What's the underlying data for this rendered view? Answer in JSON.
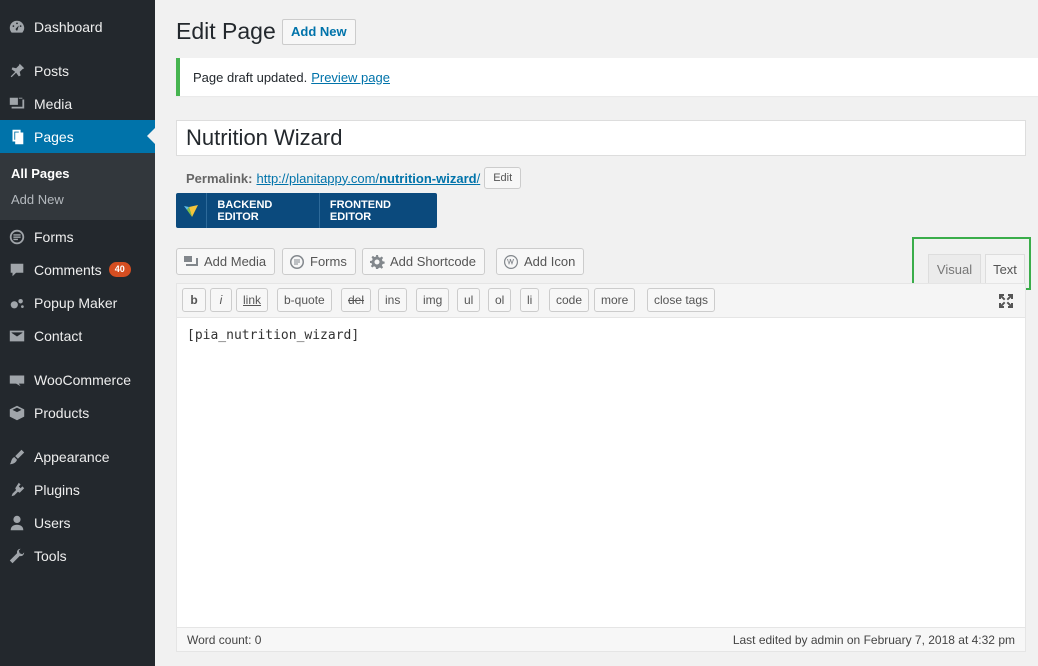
{
  "sidebar": {
    "items": [
      {
        "label": "Dashboard",
        "icon": "dashboard-icon"
      },
      {
        "label": "Posts",
        "icon": "pin-icon"
      },
      {
        "label": "Media",
        "icon": "media-icon"
      },
      {
        "label": "Pages",
        "icon": "pages-icon"
      },
      {
        "label": "Forms",
        "icon": "forms-icon"
      },
      {
        "label": "Comments",
        "icon": "comment-icon",
        "badge": "40"
      },
      {
        "label": "Popup Maker",
        "icon": "popup-icon"
      },
      {
        "label": "Contact",
        "icon": "mail-icon"
      },
      {
        "label": "WooCommerce",
        "icon": "woo-icon"
      },
      {
        "label": "Products",
        "icon": "box-icon"
      },
      {
        "label": "Appearance",
        "icon": "brush-icon"
      },
      {
        "label": "Plugins",
        "icon": "plugin-icon"
      },
      {
        "label": "Users",
        "icon": "user-icon"
      },
      {
        "label": "Tools",
        "icon": "wrench-icon"
      }
    ],
    "submenu": {
      "all_pages": "All Pages",
      "add_new": "Add New"
    }
  },
  "header": {
    "title": "Edit Page",
    "add_new": "Add New"
  },
  "notice": {
    "text": "Page draft updated.",
    "link": "Preview page"
  },
  "post": {
    "title": "Nutrition Wizard"
  },
  "permalink": {
    "label": "Permalink:",
    "url_base": "http://planitappy.com/",
    "slug": "nutrition-wizard",
    "url_tail": "/",
    "edit": "Edit"
  },
  "vc": {
    "backend": "BACKEND EDITOR",
    "frontend": "FRONTEND EDITOR"
  },
  "media_buttons": {
    "add_media": "Add Media",
    "forms": "Forms",
    "add_shortcode": "Add Shortcode",
    "add_icon": "Add Icon"
  },
  "tabs": {
    "visual": "Visual",
    "text": "Text"
  },
  "quicktags": [
    "b",
    "i",
    "link",
    "b-quote",
    "del",
    "ins",
    "img",
    "ul",
    "ol",
    "li",
    "code",
    "more",
    "close tags"
  ],
  "editor": {
    "content": "[pia_nutrition_wizard]"
  },
  "status": {
    "word_count": "Word count: 0",
    "last_edited": "Last edited by admin on February 7, 2018 at 4:32 pm"
  },
  "colors": {
    "sidebar_bg": "#23282d",
    "accent": "#0073aa",
    "notice_green": "#46b450",
    "highlight": "#3aad4a"
  }
}
